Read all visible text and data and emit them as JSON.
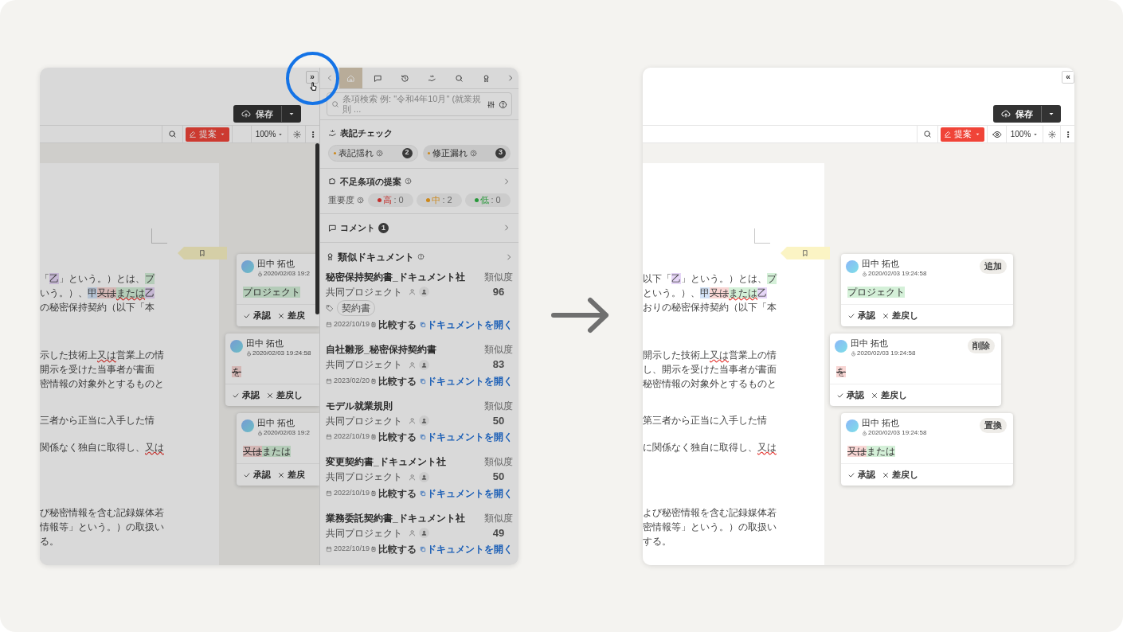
{
  "left_view": {
    "panel_toggle": "»",
    "save": {
      "label": "保存"
    },
    "toolbar": {
      "mode_label": "提案",
      "eye_button": false,
      "zoom": "100%"
    },
    "document": [
      [
        [
          {
            "text": "「",
            "kind": "plain"
          },
          {
            "text": "乙",
            "kind": "purple"
          },
          {
            "text": "」という。）とは、",
            "kind": "plain"
          },
          {
            "text": "プ",
            "kind": "added"
          }
        ],
        [
          {
            "text": "いう。）、",
            "kind": "plain"
          },
          {
            "text": "甲",
            "kind": "blue"
          },
          {
            "text": "又は",
            "kind": "deleted"
          },
          {
            "text": "または",
            "kind": "added_squiggle"
          },
          {
            "text": "乙",
            "kind": "purple"
          }
        ],
        [
          {
            "text": "の秘密保持契約（以下「本",
            "kind": "plain"
          }
        ]
      ],
      [
        [
          {
            "text": "示した技術上",
            "kind": "plain"
          },
          {
            "text": "又は",
            "kind": "squiggle"
          },
          {
            "text": "営業上の情",
            "kind": "plain"
          }
        ],
        [
          {
            "text": "開示を受けた当事者が書面",
            "kind": "plain"
          }
        ],
        [
          {
            "text": "密情報の対象外とするものと",
            "kind": "plain"
          }
        ]
      ],
      [
        [
          {
            "text": "三者から正当に入手した情",
            "kind": "plain"
          }
        ]
      ],
      [
        [
          {
            "text": "関係なく独自に取得し、",
            "kind": "plain"
          },
          {
            "text": "又は",
            "kind": "squiggle"
          }
        ]
      ],
      [
        [
          {
            "text": "び秘密情報を含む記録媒体若",
            "kind": "plain"
          }
        ],
        [
          {
            "text": "情報等」という。）の取扱い",
            "kind": "plain"
          }
        ],
        [
          {
            "text": "る。",
            "kind": "plain"
          }
        ]
      ]
    ],
    "comment_cards": [
      {
        "author": "田中 拓也",
        "time": "2020/02/03 19:2",
        "change": [
          {
            "text": "プロジェクト",
            "kind": "added"
          }
        ],
        "actions": [
          {
            "kind": "approve",
            "label": "承認"
          },
          {
            "kind": "reject",
            "label": "差戻"
          }
        ]
      },
      {
        "author": "田中 拓也",
        "time": "2020/02/03 19:24:58",
        "change": [
          {
            "text": "を",
            "kind": "deleted"
          }
        ],
        "actions": [
          {
            "kind": "approve",
            "label": "承認"
          },
          {
            "kind": "reject",
            "label": "差戻し"
          }
        ]
      },
      {
        "author": "田中 拓也",
        "time": "2020/02/03 19:2",
        "change": [
          {
            "text": "又は",
            "kind": "deleted"
          },
          {
            "text": "または",
            "kind": "added"
          }
        ],
        "actions": [
          {
            "kind": "approve",
            "label": "承認"
          },
          {
            "kind": "reject",
            "label": "差戻"
          }
        ]
      }
    ],
    "side_panel": {
      "tabs": [
        {
          "kind": "home",
          "selected": true
        },
        {
          "kind": "comment",
          "selected": false
        },
        {
          "kind": "history",
          "selected": false
        },
        {
          "kind": "proofread",
          "selected": false
        },
        {
          "kind": "search",
          "selected": false
        },
        {
          "kind": "award",
          "selected": false
        }
      ],
      "search": {
        "placeholder": "条項検索 例: \"令和4年10月\" (就業規則 ..."
      },
      "notation_check": {
        "title": "表記チェック",
        "chips": [
          {
            "label": "表記揺れ",
            "count": "2"
          },
          {
            "label": "修正漏れ",
            "count": "3"
          }
        ]
      },
      "missing_clauses": {
        "title": "不足条項の提案",
        "severity_label": "重要度",
        "levels": [
          {
            "label": "高",
            "value": ": 0",
            "color": "#c3302d"
          },
          {
            "label": "中",
            "value": ": 2",
            "color": "#cc881b"
          },
          {
            "label": "低",
            "value": ": 0",
            "color": "#28983a"
          }
        ]
      },
      "comments": {
        "title": "コメント",
        "count": "1"
      },
      "similar_docs": {
        "title": "類似ドキュメント",
        "items": [
          {
            "title": "秘密保持契約書_ドキュメント社",
            "project": "共同プロジェクト",
            "score_label": "類似度",
            "score": "96",
            "tags": [
              "契約書"
            ],
            "date": "2022/10/19",
            "compare": "比較する",
            "open": "ドキュメントを開く"
          },
          {
            "title": "自社雛形_秘密保持契約書",
            "project": "共同プロジェクト",
            "score_label": "類似度",
            "score": "83",
            "date": "2023/02/20",
            "compare": "比較する",
            "open": "ドキュメントを開く"
          },
          {
            "title": "モデル就業規則",
            "project": "共同プロジェクト",
            "score_label": "類似度",
            "score": "50",
            "date": "2022/10/19",
            "compare": "比較する",
            "open": "ドキュメントを開く"
          },
          {
            "title": "変更契約書_ドキュメント社",
            "project": "共同プロジェクト",
            "score_label": "類似度",
            "score": "50",
            "date": "2022/10/19",
            "compare": "比較する",
            "open": "ドキュメントを開く"
          },
          {
            "title": "業務委託契約書_ドキュメント社",
            "project": "共同プロジェクト",
            "score_label": "類似度",
            "score": "49",
            "date": "2022/10/19",
            "compare": "比較する",
            "open": "ドキュメントを開く"
          }
        ]
      }
    }
  },
  "right_view": {
    "panel_toggle": "«",
    "save": {
      "label": "保存"
    },
    "toolbar": {
      "mode_label": "提案",
      "eye_button": true,
      "zoom": "100%"
    },
    "document": [
      [
        [
          {
            "text": "以下「",
            "kind": "plain"
          },
          {
            "text": "乙",
            "kind": "purple"
          },
          {
            "text": "」という。）とは、",
            "kind": "plain"
          },
          {
            "text": "プ",
            "kind": "added"
          }
        ],
        [
          {
            "text": "という。）、",
            "kind": "plain"
          },
          {
            "text": "甲",
            "kind": "blue"
          },
          {
            "text": "又は",
            "kind": "deleted"
          },
          {
            "text": "または",
            "kind": "added_squiggle"
          },
          {
            "text": "乙",
            "kind": "purple"
          }
        ],
        [
          {
            "text": "おりの秘密保持契約（以下「本",
            "kind": "plain"
          }
        ]
      ],
      [
        [
          {
            "text": "開示した技術上",
            "kind": "plain"
          },
          {
            "text": "又は",
            "kind": "squiggle"
          },
          {
            "text": "営業上の情",
            "kind": "plain"
          }
        ],
        [
          {
            "text": "し、開示を受けた当事者が書面",
            "kind": "plain"
          }
        ],
        [
          {
            "text": "秘密情報の対象外とするものと",
            "kind": "plain"
          }
        ]
      ],
      [
        [
          {
            "text": "第三者から正当に入手した情",
            "kind": "plain"
          }
        ]
      ],
      [
        [
          {
            "text": "に関係なく独自に取得し、",
            "kind": "plain"
          },
          {
            "text": "又は",
            "kind": "squiggle"
          }
        ]
      ],
      [
        [
          {
            "text": "よび秘密情報を含む記録媒体若",
            "kind": "plain"
          }
        ],
        [
          {
            "text": "密情報等」という。）の取扱い",
            "kind": "plain"
          }
        ],
        [
          {
            "text": "する。",
            "kind": "plain"
          }
        ]
      ]
    ],
    "comment_cards": [
      {
        "author": "田中 拓也",
        "time": "2020/02/03 19:24:58",
        "badge": "追加",
        "change": [
          {
            "text": "プロジェクト",
            "kind": "added"
          }
        ],
        "actions": [
          {
            "kind": "approve",
            "label": "承認"
          },
          {
            "kind": "reject",
            "label": "差戻し"
          }
        ]
      },
      {
        "author": "田中 拓也",
        "time": "2020/02/03 19:24:58",
        "badge": "削除",
        "change": [
          {
            "text": "を",
            "kind": "deleted"
          }
        ],
        "actions": [
          {
            "kind": "approve",
            "label": "承認"
          },
          {
            "kind": "reject",
            "label": "差戻し"
          }
        ]
      },
      {
        "author": "田中 拓也",
        "time": "2020/02/03 19:24:58",
        "badge": "置換",
        "change": [
          {
            "text": "又は",
            "kind": "deleted"
          },
          {
            "text": "または",
            "kind": "added"
          }
        ],
        "actions": [
          {
            "kind": "approve",
            "label": "承認"
          },
          {
            "kind": "reject",
            "label": "差戻し"
          }
        ]
      }
    ]
  }
}
